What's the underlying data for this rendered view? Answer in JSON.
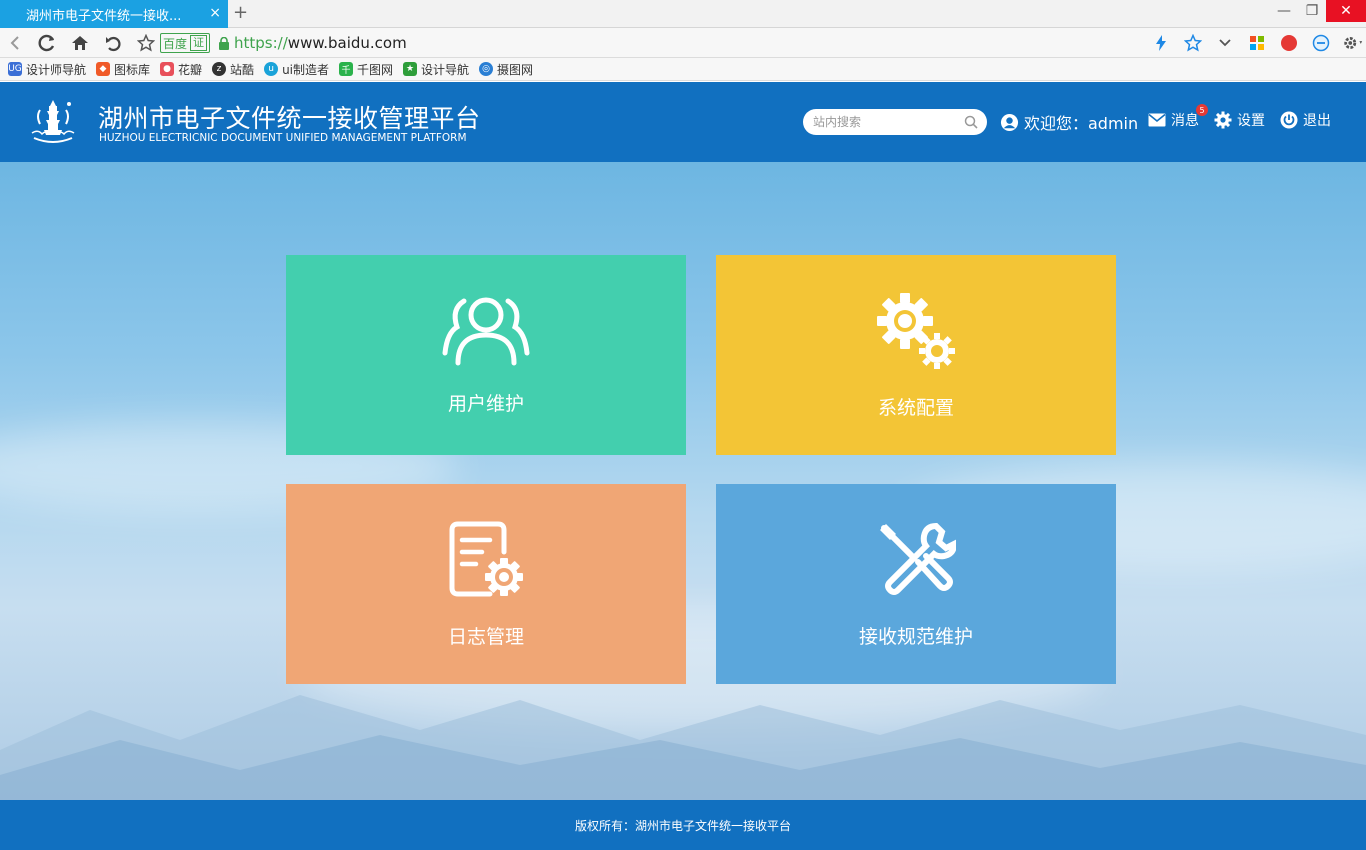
{
  "browser": {
    "tab_title": "湖州市电子文件统一接收...",
    "tab_close": "×",
    "new_tab": "+",
    "window": {
      "minimize": "—",
      "restore": "❐",
      "close": "✕"
    },
    "identity_badge": "百度",
    "identity_cert": "证",
    "url_scheme": "https://",
    "url_host": "www.baidu.com",
    "bookmarks": [
      {
        "label": "设计师导航",
        "icon": "ug-icon",
        "color": "#3b6fd6"
      },
      {
        "label": "图标库",
        "icon": "iconlib-icon",
        "color": "#f05a28"
      },
      {
        "label": "花瓣",
        "icon": "huaban-icon",
        "color": "#e8505b"
      },
      {
        "label": "站酷",
        "icon": "zcool-icon",
        "color": "#333333"
      },
      {
        "label": "ui制造者",
        "icon": "uimaker-icon",
        "color": "#1aa3d9"
      },
      {
        "label": "千图网",
        "icon": "qiantu-icon",
        "color": "#2bb24c"
      },
      {
        "label": "设计导航",
        "icon": "shield-icon",
        "color": "#2e9e3a"
      },
      {
        "label": "摄图网",
        "icon": "sheji-icon",
        "color": "#2a7fd4"
      }
    ]
  },
  "header": {
    "title": "湖州市电子文件统一接收管理平台",
    "subtitle": "HUZHOU ELECTRICNIC DOCUMENT UNIFIED MANAGEMENT PLATFORM",
    "search_placeholder": "站内搜索",
    "welcome": "欢迎您：admin",
    "messages_label": "消息",
    "messages_count": "5",
    "settings_label": "设置",
    "logout_label": "退出"
  },
  "tiles": [
    {
      "label": "用户维护",
      "icon": "users-icon",
      "color": "#43cfae"
    },
    {
      "label": "系统配置",
      "icon": "gears-icon",
      "color": "#f3c536"
    },
    {
      "label": "日志管理",
      "icon": "log-settings-icon",
      "color": "#f0a675"
    },
    {
      "label": "接收规范维护",
      "icon": "tools-icon",
      "color": "#5ba7dc"
    }
  ],
  "footer": {
    "copyright": "版权所有：湖州市电子文件统一接收平台"
  },
  "colors": {
    "primary": "#1170c0",
    "tab_active": "#1ba1e2"
  }
}
